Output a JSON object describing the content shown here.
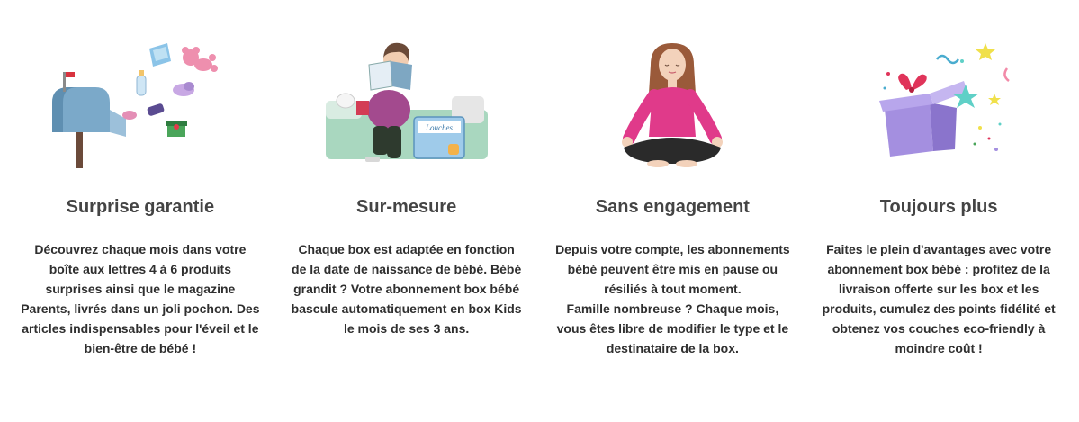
{
  "features": [
    {
      "title": "Surprise garantie",
      "description": "Découvrez chaque mois dans votre\nboîte aux lettres 4 à 6 produits\nsurprises ainsi que le magazine\nParents, livrés dans un joli pochon. Des\narticles indispensables pour l'éveil et le\nbien-être de bébé !",
      "icon": "mailbox-gifts-icon"
    },
    {
      "title": "Sur-mesure",
      "description": "Chaque box est adaptée en fonction\nde la date de naissance de bébé. Bébé\ngrandit ? Votre abonnement box bébé\nbascule automatiquement en box Kids\nle mois de ses 3 ans.",
      "icon": "pregnant-woman-reading-icon",
      "box_label": "Louches"
    },
    {
      "title": "Sans engagement",
      "description": "Depuis votre compte, les abonnements\nbébé peuvent être mis en pause ou\nrésiliés à tout moment.\nFamille nombreuse ? Chaque mois,\nvous êtes libre de modifier le type et le\ndestinataire de la box.",
      "icon": "meditating-woman-icon"
    },
    {
      "title": "Toujours plus",
      "description": "Faites le plein d'avantages avec votre\nabonnement box bébé : profitez de la\nlivraison offerte sur les box et les\nproduits, cumulez des points fidélité et\nobtenez vos couches eco-friendly à\nmoindre coût !",
      "icon": "gift-box-stars-icon"
    }
  ]
}
